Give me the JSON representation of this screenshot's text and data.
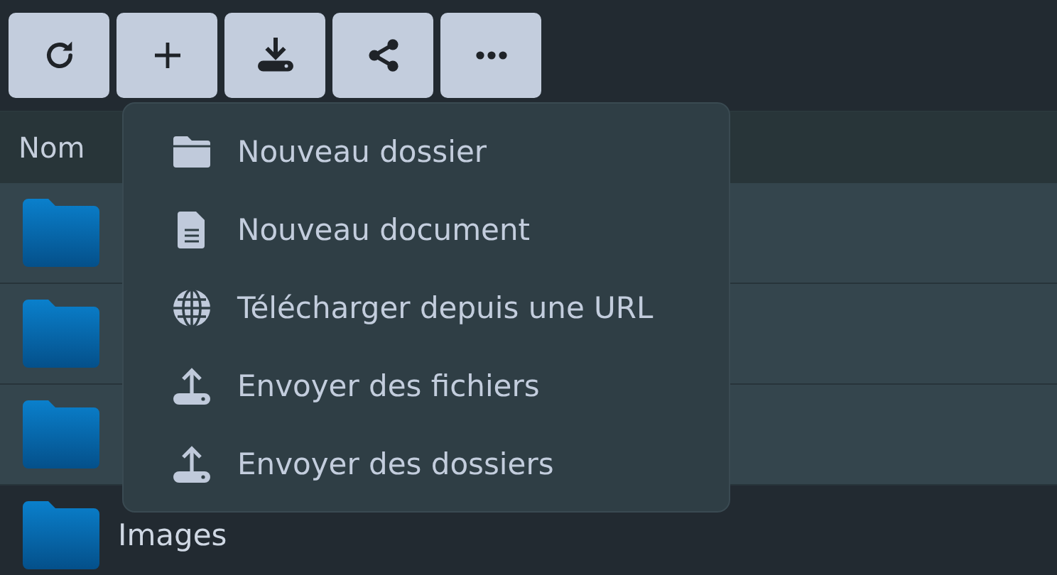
{
  "toolbar": {
    "buttons": [
      {
        "kind": "refresh"
      },
      {
        "kind": "add"
      },
      {
        "kind": "download"
      },
      {
        "kind": "share"
      },
      {
        "kind": "more"
      }
    ]
  },
  "table": {
    "columns": [
      "Nom"
    ],
    "rows": [
      {
        "selected": true
      },
      {
        "selected": true
      },
      {
        "selected": true
      },
      {
        "name": "Images",
        "selected": false
      }
    ]
  },
  "menu": {
    "items": [
      {
        "kind": "folder",
        "label": "Nouveau dossier"
      },
      {
        "kind": "document",
        "label": "Nouveau document"
      },
      {
        "kind": "globe",
        "label": "Télécharger depuis une URL"
      },
      {
        "kind": "upload",
        "label": "Envoyer des fichiers"
      },
      {
        "kind": "upload",
        "label": "Envoyer des dossiers"
      }
    ]
  }
}
